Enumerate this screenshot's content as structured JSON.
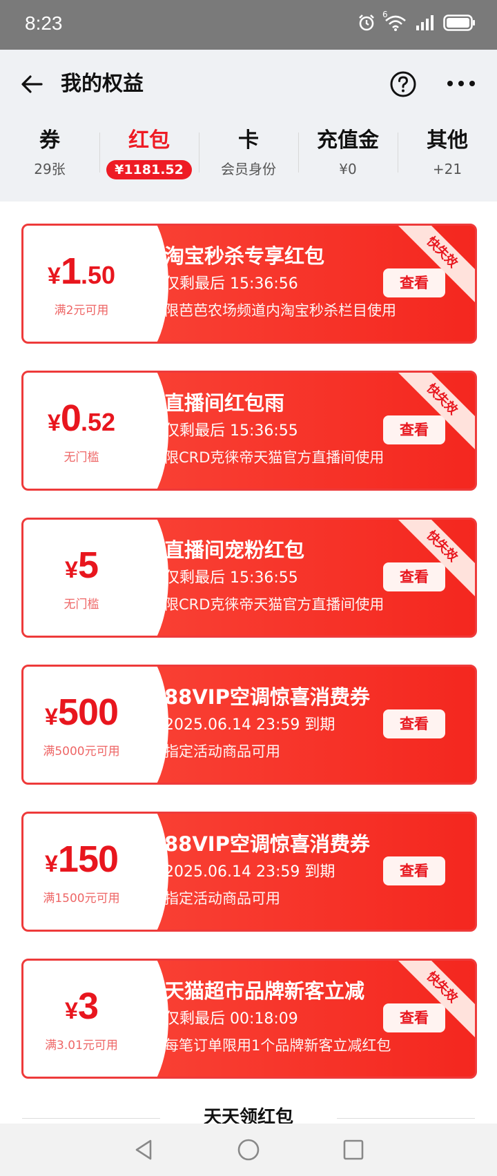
{
  "status_bar": {
    "time": "8:23",
    "network": "6"
  },
  "header": {
    "title": "我的权益"
  },
  "tabs": [
    {
      "label": "券",
      "sub": "29张"
    },
    {
      "label": "红包",
      "sub": "¥1181.52",
      "active": true
    },
    {
      "label": "卡",
      "sub": "会员身份"
    },
    {
      "label": "充值金",
      "sub": "¥0"
    },
    {
      "label": "其他",
      "sub": "+21"
    }
  ],
  "coupons": [
    {
      "yen": "¥",
      "int": "1",
      "dec": ".50",
      "cond": "满2元可用",
      "title": "淘宝秒杀专享红包",
      "expire": "仅剩最后 15:36:56",
      "desc": "限芭芭农场频道内淘宝秒杀栏目使用",
      "btn": "查看",
      "ribbon": "快失效"
    },
    {
      "yen": "¥",
      "int": "0",
      "dec": ".52",
      "cond": "无门槛",
      "title": "直播间红包雨",
      "expire": "仅剩最后 15:36:55",
      "desc": "限CRD克徕帝天猫官方直播间使用",
      "btn": "查看",
      "ribbon": "快失效"
    },
    {
      "yen": "¥",
      "int": "5",
      "dec": "",
      "cond": "无门槛",
      "title": "直播间宠粉红包",
      "expire": "仅剩最后 15:36:55",
      "desc": "限CRD克徕帝天猫官方直播间使用",
      "btn": "查看",
      "ribbon": "快失效"
    },
    {
      "yen": "¥",
      "int": "500",
      "dec": "",
      "cond": "满5000元可用",
      "title": "88VIP空调惊喜消费券",
      "expire": "2025.06.14 23:59 到期",
      "desc": "指定活动商品可用",
      "btn": "查看",
      "ribbon": ""
    },
    {
      "yen": "¥",
      "int": "150",
      "dec": "",
      "cond": "满1500元可用",
      "title": "88VIP空调惊喜消费券",
      "expire": "2025.06.14 23:59 到期",
      "desc": "指定活动商品可用",
      "btn": "查看",
      "ribbon": ""
    },
    {
      "yen": "¥",
      "int": "3",
      "dec": "",
      "cond": "满3.01元可用",
      "title": "天猫超市品牌新客立减",
      "expire": "仅剩最后 00:18:09",
      "desc": "每笔订单限用1个品牌新客立减红包",
      "btn": "查看",
      "ribbon": "快失效"
    }
  ],
  "section": {
    "title": "天天领红包"
  },
  "icons": [
    "alarm-icon",
    "wifi-icon",
    "signal-icon",
    "battery-icon",
    "back-arrow-icon",
    "help-icon",
    "more-icon",
    "nav-back-icon",
    "nav-home-icon",
    "nav-recents-icon"
  ]
}
